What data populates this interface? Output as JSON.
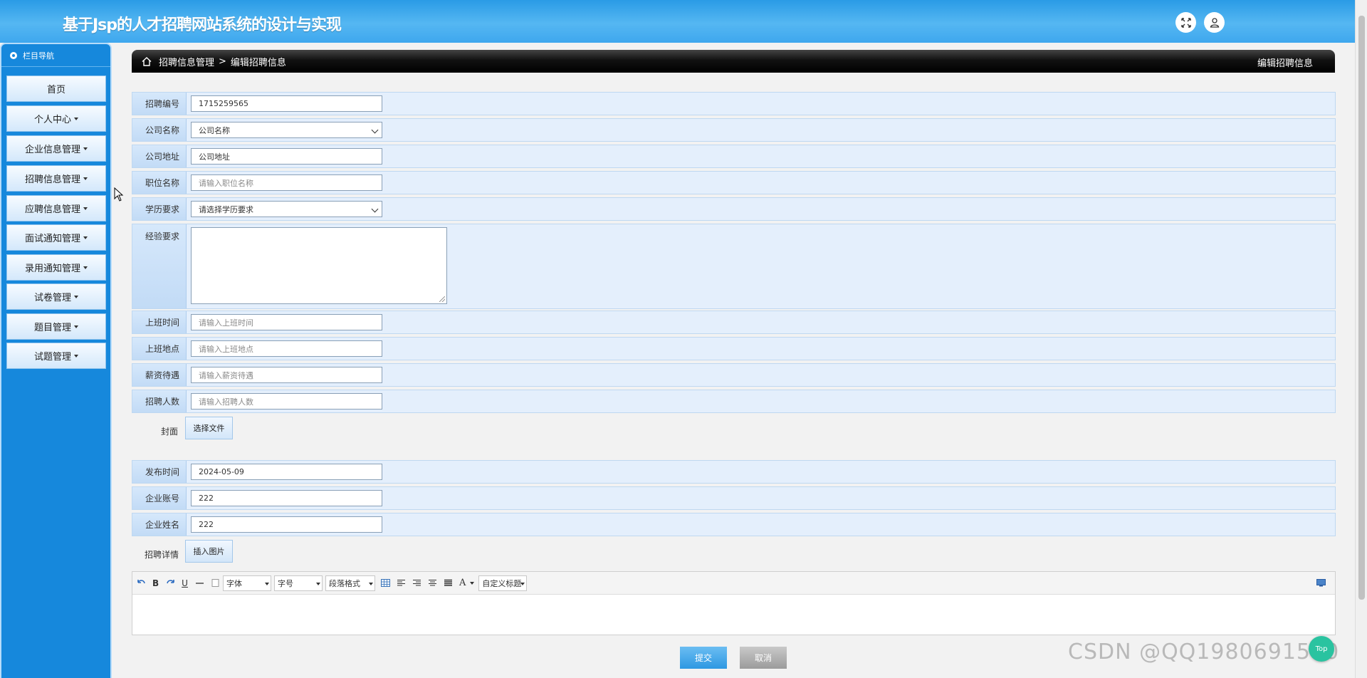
{
  "header": {
    "title": "基于Jsp的人才招聘网站系统的设计与实现"
  },
  "sidebar": {
    "title": "栏目导航",
    "items": [
      {
        "label": "首页",
        "dropdown": false
      },
      {
        "label": "个人中心",
        "dropdown": true
      },
      {
        "label": "企业信息管理",
        "dropdown": true
      },
      {
        "label": "招聘信息管理",
        "dropdown": true
      },
      {
        "label": "应聘信息管理",
        "dropdown": true
      },
      {
        "label": "面试通知管理",
        "dropdown": true
      },
      {
        "label": "录用通知管理",
        "dropdown": true
      },
      {
        "label": "试卷管理",
        "dropdown": true
      },
      {
        "label": "题目管理",
        "dropdown": true
      },
      {
        "label": "试题管理",
        "dropdown": true
      }
    ]
  },
  "breadcrumb": {
    "parent": "招聘信息管理",
    "separator": ">",
    "current": "编辑招聘信息",
    "right_title": "编辑招聘信息"
  },
  "form": {
    "recruit_no": {
      "label": "招聘编号",
      "value": "1715259565"
    },
    "company_name": {
      "label": "公司名称",
      "value": "公司名称"
    },
    "company_addr": {
      "label": "公司地址",
      "value": "公司地址"
    },
    "position": {
      "label": "职位名称",
      "placeholder": "请输入职位名称"
    },
    "education": {
      "label": "学历要求",
      "value": "请选择学历要求"
    },
    "experience": {
      "label": "经验要求",
      "value": ""
    },
    "work_time": {
      "label": "上班时间",
      "placeholder": "请输入上班时间"
    },
    "work_place": {
      "label": "上班地点",
      "placeholder": "请输入上班地点"
    },
    "salary": {
      "label": "薪资待遇",
      "placeholder": "请输入薪资待遇"
    },
    "headcount": {
      "label": "招聘人数",
      "placeholder": "请输入招聘人数"
    },
    "cover": {
      "label": "封面",
      "button": "选择文件"
    },
    "publish_time": {
      "label": "发布时间",
      "value": "2024-05-09"
    },
    "company_account": {
      "label": "企业账号",
      "value": "222"
    },
    "company_fullname": {
      "label": "企业姓名",
      "value": "222"
    },
    "detail": {
      "label": "招聘详情",
      "button": "插入图片"
    }
  },
  "editor": {
    "bold": "B",
    "underline": "U",
    "font_select": "字体",
    "size_select": "字号",
    "paragraph_select": "段落格式",
    "font_color": "A",
    "custom_title": "自定义标题"
  },
  "actions": {
    "submit": "提交",
    "cancel": "取消"
  },
  "watermark": "CSDN @QQ1980691580",
  "float_button": "Top",
  "colors": {
    "header": "#3ea7ee",
    "sidebar": "#1688dc",
    "row_bg": "#e4effc",
    "submit": "#2d98e2"
  }
}
